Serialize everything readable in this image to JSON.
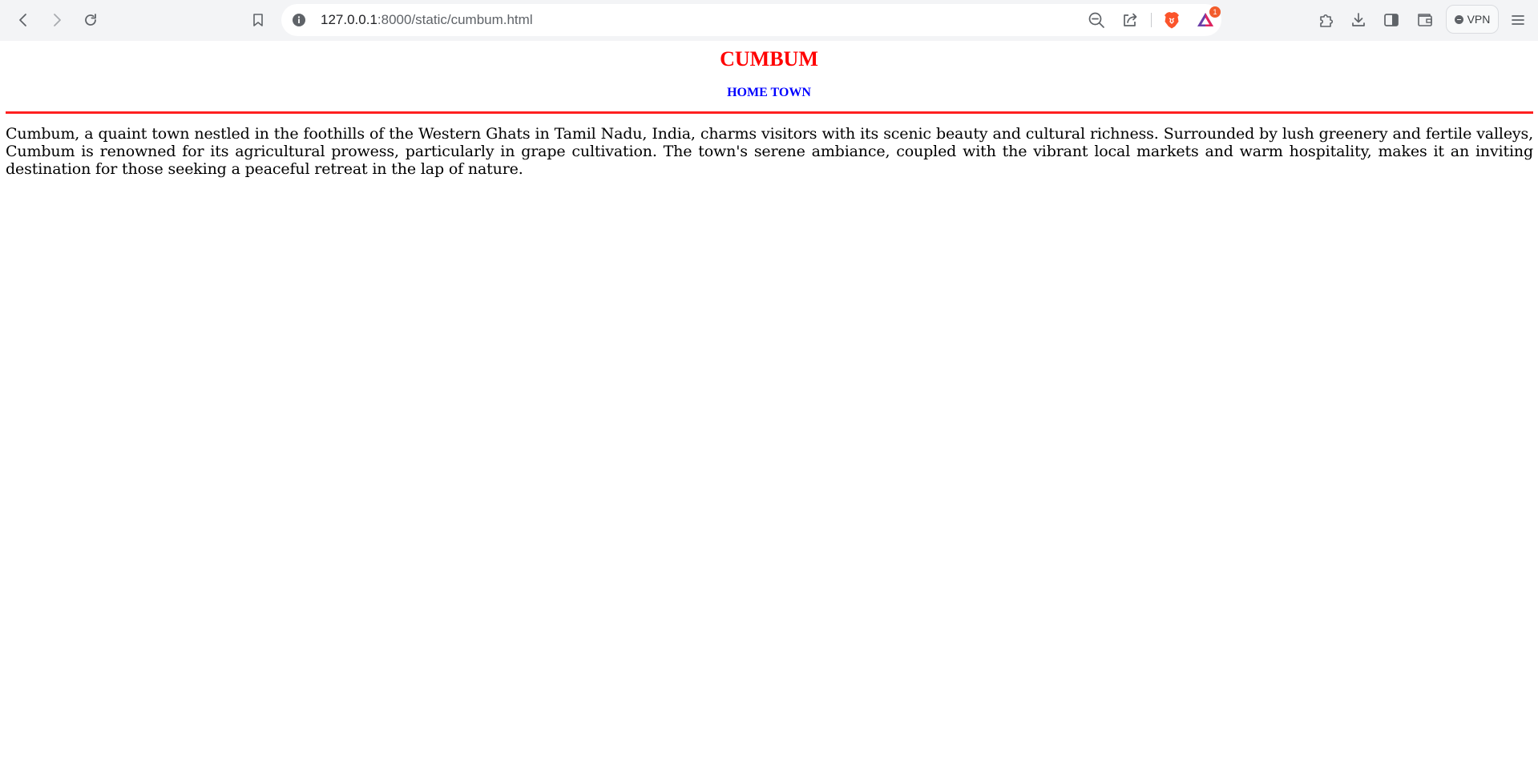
{
  "browser": {
    "url_host": "127.0.0.1",
    "url_rest": ":8000/static/cumbum.html",
    "brave_rewards_badge": "1",
    "vpn_label": "VPN",
    "icons": {
      "back": "back-arrow-icon",
      "forward": "forward-arrow-icon",
      "reload": "reload-icon",
      "bookmark": "bookmark-icon",
      "site_info": "info-icon",
      "zoom": "zoom-out-icon",
      "share": "share-icon",
      "brave_shields": "brave-lion-icon",
      "brave_rewards": "triangle-rewards-icon",
      "extensions": "puzzle-piece-icon",
      "downloads": "download-icon",
      "sidebar": "sidebar-icon",
      "wallet": "wallet-icon",
      "menu": "hamburger-menu-icon"
    }
  },
  "page": {
    "title": "CUMBUM",
    "subtitle": "HOME TOWN",
    "paragraph": "Cumbum, a quaint town nestled in the foothills of the Western Ghats in Tamil Nadu, India, charms visitors with its scenic beauty and cultural richness. Surrounded by lush greenery and fertile valleys, Cumbum is renowned for its agricultural prowess, particularly in grape cultivation. The town's serene ambiance, coupled with the vibrant local markets and warm hospitality, makes it an inviting destination for those seeking a peaceful retreat in the lap of nature.",
    "colors": {
      "title": "#ff0000",
      "subtitle": "#0000ff",
      "divider": "#ff2020",
      "text": "#000000"
    }
  }
}
